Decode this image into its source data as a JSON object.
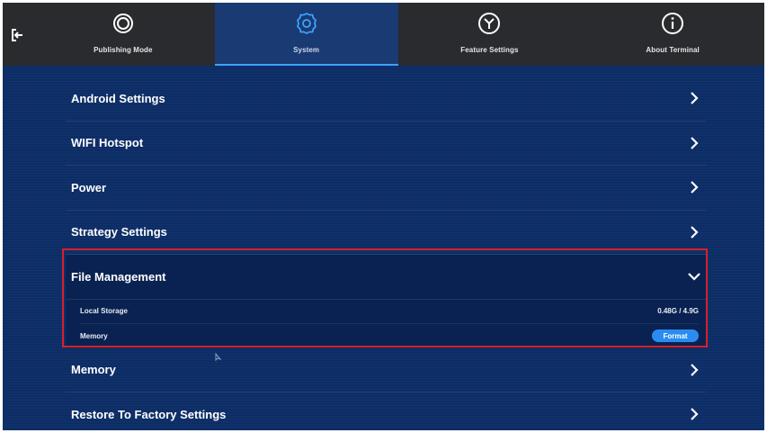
{
  "nav": {
    "back_icon": "exit-icon",
    "tabs": [
      {
        "label": "Publishing Mode",
        "icon": "ring-icon",
        "active": false
      },
      {
        "label": "System",
        "icon": "gear-icon",
        "active": true
      },
      {
        "label": "Feature Settings",
        "icon": "y-circle-icon",
        "active": false
      },
      {
        "label": "About Terminal",
        "icon": "info-icon",
        "active": false
      }
    ]
  },
  "settings": {
    "rows": [
      {
        "label": "Android Settings"
      },
      {
        "label": "WIFI Hotspot"
      },
      {
        "label": "Power"
      },
      {
        "label": "Strategy Settings"
      }
    ],
    "file_management": {
      "label": "File Management",
      "local_storage_label": "Local Storage",
      "local_storage_value": "0.48G / 4.9G",
      "memory_label": "Memory",
      "format_label": "Format"
    },
    "rows_after": [
      {
        "label": "Memory"
      },
      {
        "label": "Restore To Factory Settings"
      }
    ]
  },
  "colors": {
    "background": "#0d2d66",
    "topbar": "#2a2b2e",
    "active_tab_underline": "#3fa2ff",
    "format_button": "#2a8cf0",
    "highlight_box": "#d8202a"
  }
}
